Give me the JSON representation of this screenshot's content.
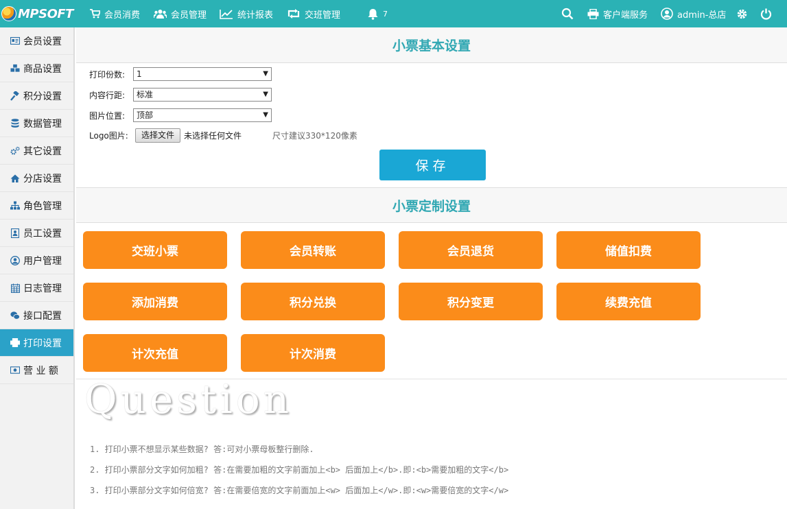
{
  "brand": {
    "logo_text": "MPSOFT"
  },
  "topnav": {
    "items": [
      {
        "label": "会员消费",
        "icon": "cart-icon"
      },
      {
        "label": "会员管理",
        "icon": "users-icon"
      },
      {
        "label": "统计报表",
        "icon": "line-chart-icon"
      },
      {
        "label": "交班管理",
        "icon": "retweet-icon"
      }
    ],
    "notification_count": "7",
    "customer_service": "客户端服务",
    "user": "admin-总店"
  },
  "sidebar": {
    "items": [
      {
        "label": "会员设置",
        "icon": "id-card-icon"
      },
      {
        "label": "商品设置",
        "icon": "cubes-icon"
      },
      {
        "label": "积分设置",
        "icon": "gavel-icon"
      },
      {
        "label": "数据管理",
        "icon": "database-icon"
      },
      {
        "label": "其它设置",
        "icon": "cogs-icon"
      },
      {
        "label": "分店设置",
        "icon": "home-icon"
      },
      {
        "label": "角色管理",
        "icon": "sitemap-icon"
      },
      {
        "label": "员工设置",
        "icon": "user-badge-icon"
      },
      {
        "label": "用户管理",
        "icon": "user-circle-icon"
      },
      {
        "label": "日志管理",
        "icon": "calendar-icon"
      },
      {
        "label": "接口配置",
        "icon": "wechat-icon"
      },
      {
        "label": "打印设置",
        "icon": "printer-icon",
        "active": true
      },
      {
        "label": "营 业 额",
        "icon": "money-icon"
      }
    ]
  },
  "basic_settings": {
    "title": "小票基本设置",
    "copies_label": "打印份数:",
    "copies_value": "1",
    "spacing_label": "内容行距:",
    "spacing_value": "标准",
    "image_pos_label": "图片位置:",
    "image_pos_value": "顶部",
    "logo_label": "Logo图片:",
    "file_button": "选择文件",
    "file_status": "未选择任何文件",
    "size_hint": "尺寸建议330*120像素",
    "save_label": "保存"
  },
  "custom_settings": {
    "title": "小票定制设置",
    "tiles": [
      "交班小票",
      "会员转账",
      "会员退货",
      "储值扣费",
      "添加消费",
      "积分兑换",
      "积分变更",
      "续费充值",
      "计次充值",
      "计次消费"
    ]
  },
  "question": {
    "title": "Question",
    "items": [
      "1. 打印小票不想显示某些数据? 答:可对小票母板整行删除.",
      "2. 打印小票部分文字如何加粗? 答:在需要加粗的文字前面加上<b> 后面加上</b>.即:<b>需要加粗的文字</b>",
      "3. 打印小票部分文字如何倍宽? 答:在需要倍宽的文字前面加上<w> 后面加上</w>.即:<w>需要倍宽的文字</w>"
    ]
  },
  "colors": {
    "topbar": "#2bb2b5",
    "accent": "#31a8b3",
    "tile": "#fb8c1a",
    "save": "#1aa7d5",
    "active_side": "#2ba2c8"
  }
}
